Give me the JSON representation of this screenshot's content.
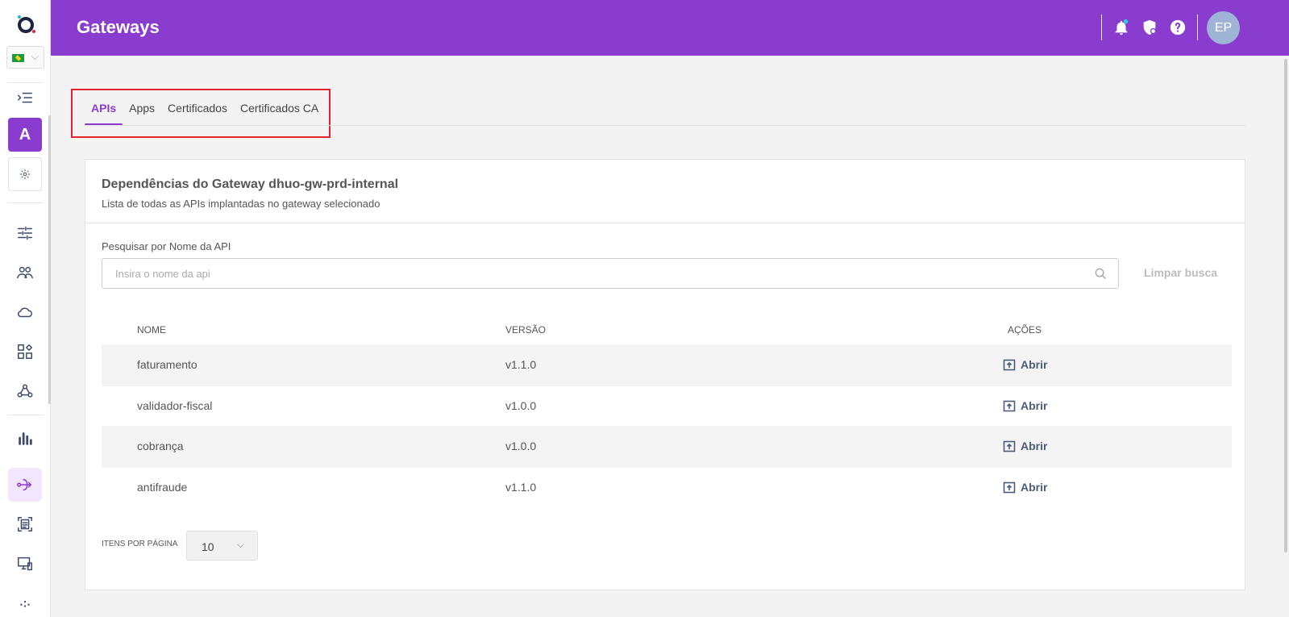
{
  "header": {
    "title": "Gateways",
    "avatar_initials": "EP"
  },
  "sidebar": {
    "language_flag": "brazil-flag",
    "items": [
      {
        "name": "collapse-menu-icon"
      },
      {
        "name": "A"
      },
      {
        "name": "gear-icon"
      },
      {
        "name": "sliders-icon"
      },
      {
        "name": "users-icon"
      },
      {
        "name": "cloud-icon"
      },
      {
        "name": "apps-icon"
      },
      {
        "name": "webhook-icon"
      },
      {
        "name": "bar-chart-icon"
      },
      {
        "name": "gateway-icon",
        "active": true
      },
      {
        "name": "document-scan-icon"
      },
      {
        "name": "monitor-icon"
      }
    ]
  },
  "tabs": [
    {
      "label": "APIs",
      "active": true
    },
    {
      "label": "Apps"
    },
    {
      "label": "Certificados"
    },
    {
      "label": "Certificados CA"
    }
  ],
  "card": {
    "title": "Dependências do Gateway dhuo-gw-prd-internal",
    "subtitle": "Lista de todas as APIs implantadas no gateway selecionado"
  },
  "search": {
    "label": "Pesquisar por Nome da API",
    "placeholder": "Insira o nome da api",
    "value": "",
    "clear_label": "Limpar busca"
  },
  "table": {
    "columns": [
      "NOME",
      "VERSÃO",
      "AÇÕES"
    ],
    "action_label": "Abrir",
    "rows": [
      {
        "name": "faturamento",
        "version": "v1.1.0"
      },
      {
        "name": "validador-fiscal",
        "version": "v1.0.0"
      },
      {
        "name": "cobrança",
        "version": "v1.0.0"
      },
      {
        "name": "antifraude",
        "version": "v1.1.0"
      }
    ]
  },
  "pagination": {
    "label": "ITENS POR PÁGINA",
    "per_page": "10"
  },
  "colors": {
    "brand": "#8a3ccf",
    "highlight_frame": "#e0232f",
    "action": "#4b5b7c"
  }
}
